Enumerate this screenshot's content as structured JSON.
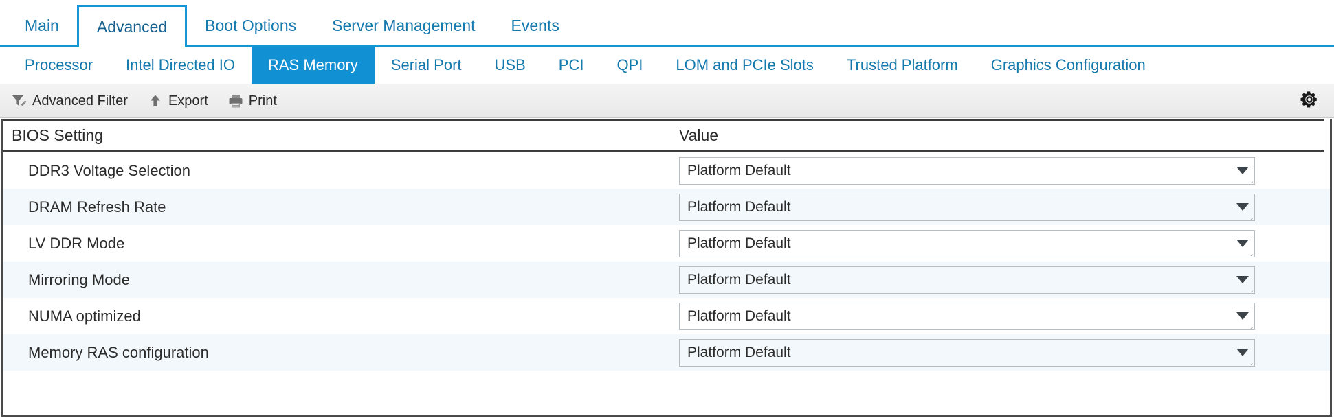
{
  "primary_tabs": [
    {
      "label": "Main",
      "active": false
    },
    {
      "label": "Advanced",
      "active": true
    },
    {
      "label": "Boot Options",
      "active": false
    },
    {
      "label": "Server Management",
      "active": false
    },
    {
      "label": "Events",
      "active": false
    }
  ],
  "secondary_tabs": [
    {
      "label": "Processor",
      "active": false
    },
    {
      "label": "Intel Directed IO",
      "active": false
    },
    {
      "label": "RAS Memory",
      "active": true
    },
    {
      "label": "Serial Port",
      "active": false
    },
    {
      "label": "USB",
      "active": false
    },
    {
      "label": "PCI",
      "active": false
    },
    {
      "label": "QPI",
      "active": false
    },
    {
      "label": "LOM and PCIe Slots",
      "active": false
    },
    {
      "label": "Trusted Platform",
      "active": false
    },
    {
      "label": "Graphics Configuration",
      "active": false
    }
  ],
  "toolbar": {
    "advanced_filter_label": "Advanced Filter",
    "export_label": "Export",
    "print_label": "Print",
    "filter_icon": "funnel-pencil-icon",
    "export_icon": "up-arrow-icon",
    "print_icon": "printer-icon",
    "settings_icon": "gear-icon"
  },
  "table": {
    "columns": [
      "BIOS Setting",
      "Value"
    ],
    "rows": [
      {
        "setting": "DDR3 Voltage Selection",
        "value": "Platform Default"
      },
      {
        "setting": "DRAM Refresh Rate",
        "value": "Platform Default"
      },
      {
        "setting": "LV DDR Mode",
        "value": "Platform Default"
      },
      {
        "setting": "Mirroring Mode",
        "value": "Platform Default"
      },
      {
        "setting": "NUMA optimized",
        "value": "Platform Default"
      },
      {
        "setting": "Memory RAS configuration",
        "value": "Platform Default"
      }
    ]
  },
  "colors": {
    "accent_blue": "#1190d4",
    "link_blue": "#1479ad",
    "row_alt": "#f2f8fb",
    "frame": "#4a4a4a"
  }
}
